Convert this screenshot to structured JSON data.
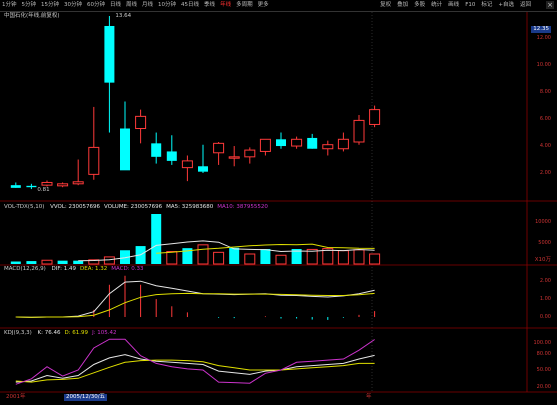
{
  "toolbar": {
    "periods": [
      "1分钟",
      "5分钟",
      "15分钟",
      "30分钟",
      "60分钟",
      "日线",
      "周线",
      "月线",
      "10分钟",
      "45日线",
      "季线",
      "年线",
      "多周期",
      "更多"
    ],
    "active_period": "年线",
    "right_items": [
      "复权",
      "叠加",
      "多股",
      "统计",
      "画线",
      "F10",
      "标记",
      "+自选",
      "返回"
    ]
  },
  "stock": {
    "name": "中国石化(年线,前复权)",
    "high_marker": "13.64",
    "low_marker": "0.81"
  },
  "price_axis": {
    "current": "12.35",
    "ticks": [
      "12.00",
      "10.00",
      "8.00",
      "6.00",
      "4.00",
      "2.00"
    ]
  },
  "vol": {
    "header": "VOL-TDX(5,10)",
    "items": [
      {
        "label": "VVOL:",
        "value": "230057696",
        "color": "#e6e6e6"
      },
      {
        "label": "VOLUME:",
        "value": "230057696",
        "color": "#e6e6e6"
      },
      {
        "label": "MA5:",
        "value": "325983680",
        "color": "#e6e6e6"
      },
      {
        "label": "MA10:",
        "value": "387955520",
        "color": "#cc33cc"
      }
    ],
    "axis": [
      "10000",
      "5000"
    ],
    "unit": "X10万"
  },
  "macd": {
    "header": "MACD(12,26,9)",
    "items": [
      {
        "label": "DIF:",
        "value": "1.49",
        "color": "#e6e6e6"
      },
      {
        "label": "DEA:",
        "value": "1.32",
        "color": "#e0e000"
      },
      {
        "label": "MACD:",
        "value": "0.33",
        "color": "#cc33cc"
      }
    ],
    "axis": [
      "2.00",
      "1.00",
      "0.00"
    ]
  },
  "kdj": {
    "header": "KDJ(9,3,3)",
    "items": [
      {
        "label": "K:",
        "value": "76.46",
        "color": "#e6e6e6"
      },
      {
        "label": "D:",
        "value": "61.99",
        "color": "#e0e000"
      },
      {
        "label": "J:",
        "value": "105.42",
        "color": "#cc33cc"
      }
    ],
    "axis": [
      "100.00",
      "80.00",
      "50.00",
      "20.00"
    ]
  },
  "timeline": {
    "start": "2001年",
    "cursor": "2005/12/30/五",
    "end_marker": "年"
  },
  "colors": {
    "up": "#ff3a3a",
    "down": "#00ffff",
    "dif": "#e6e6e6",
    "dea": "#e0e000",
    "j": "#cc33cc"
  },
  "chart_data": {
    "type": "candlestick",
    "candles": [
      {
        "o": 1.1,
        "h": 1.3,
        "l": 0.9,
        "c": 0.9
      },
      {
        "o": 1.05,
        "h": 1.2,
        "l": 0.81,
        "c": 0.95
      },
      {
        "o": 1.1,
        "h": 1.45,
        "l": 1.0,
        "c": 1.3
      },
      {
        "o": 1.05,
        "h": 1.3,
        "l": 0.95,
        "c": 1.2
      },
      {
        "o": 1.2,
        "h": 3.0,
        "l": 1.1,
        "c": 1.35
      },
      {
        "o": 1.9,
        "h": 6.9,
        "l": 1.5,
        "c": 3.9
      },
      {
        "o": 12.9,
        "h": 13.64,
        "l": 5.0,
        "c": 8.7
      },
      {
        "o": 5.3,
        "h": 7.3,
        "l": 2.5,
        "c": 2.2
      },
      {
        "o": 5.3,
        "h": 6.7,
        "l": 4.2,
        "c": 6.2
      },
      {
        "o": 4.2,
        "h": 5.0,
        "l": 2.7,
        "c": 3.2
      },
      {
        "o": 3.6,
        "h": 4.8,
        "l": 2.6,
        "c": 2.9
      },
      {
        "o": 2.4,
        "h": 3.3,
        "l": 1.4,
        "c": 2.9
      },
      {
        "o": 2.5,
        "h": 4.1,
        "l": 2.0,
        "c": 2.1
      },
      {
        "o": 3.5,
        "h": 4.3,
        "l": 2.6,
        "c": 4.2
      },
      {
        "o": 3.1,
        "h": 4.0,
        "l": 2.5,
        "c": 3.2
      },
      {
        "o": 3.2,
        "h": 3.9,
        "l": 2.7,
        "c": 3.7
      },
      {
        "o": 3.6,
        "h": 4.5,
        "l": 3.3,
        "c": 4.5
      },
      {
        "o": 4.5,
        "h": 5.0,
        "l": 3.8,
        "c": 4.0
      },
      {
        "o": 4.0,
        "h": 4.7,
        "l": 3.8,
        "c": 4.5
      },
      {
        "o": 4.6,
        "h": 4.9,
        "l": 3.8,
        "c": 3.8
      },
      {
        "o": 3.8,
        "h": 4.4,
        "l": 3.3,
        "c": 4.1
      },
      {
        "o": 3.8,
        "h": 5.0,
        "l": 3.6,
        "c": 4.5
      },
      {
        "o": 4.3,
        "h": 6.3,
        "l": 4.1,
        "c": 5.9
      },
      {
        "o": 5.6,
        "h": 7.0,
        "l": 5.4,
        "c": 6.7
      }
    ],
    "volume": [
      0.6,
      0.7,
      0.9,
      0.8,
      0.8,
      1.0,
      1.7,
      3.3,
      4.3,
      12.0,
      3.0,
      3.8,
      4.6,
      2.8,
      3.9,
      2.4,
      3.6,
      2.1,
      3.6,
      3.5,
      3.7,
      3.2,
      3.4,
      2.4
    ],
    "volume_up": [
      false,
      false,
      true,
      false,
      false,
      true,
      true,
      false,
      false,
      false,
      true,
      false,
      true,
      true,
      false,
      true,
      false,
      true,
      false,
      true,
      true,
      true,
      true,
      true
    ],
    "vol_ma5": [
      null,
      null,
      null,
      null,
      0.76,
      0.84,
      1.04,
      1.52,
      2.22,
      4.46,
      4.86,
      5.28,
      5.54,
      5.24,
      3.62,
      3.5,
      3.46,
      3.0,
      3.12,
      3.04,
      3.3,
      3.22,
      3.48,
      3.28
    ],
    "vol_ma10": [
      null,
      null,
      null,
      null,
      null,
      null,
      null,
      null,
      null,
      2.6,
      2.84,
      3.14,
      3.56,
      3.76,
      4.08,
      4.36,
      4.56,
      4.68,
      4.62,
      4.78,
      3.96,
      3.9,
      3.78,
      3.74
    ],
    "dif": [
      0.0,
      -0.02,
      0.0,
      0.0,
      0.05,
      0.3,
      1.3,
      1.95,
      2.0,
      1.75,
      1.6,
      1.45,
      1.3,
      1.28,
      1.25,
      1.28,
      1.3,
      1.22,
      1.2,
      1.15,
      1.12,
      1.18,
      1.3,
      1.49
    ],
    "dea": [
      0.0,
      -0.01,
      0.0,
      0.0,
      0.02,
      0.1,
      0.4,
      0.8,
      1.1,
      1.25,
      1.3,
      1.32,
      1.3,
      1.3,
      1.28,
      1.28,
      1.28,
      1.26,
      1.24,
      1.22,
      1.2,
      1.2,
      1.24,
      1.32
    ],
    "macd": [
      0.0,
      -0.02,
      0.0,
      0.0,
      0.06,
      0.4,
      1.8,
      2.3,
      1.8,
      1.0,
      0.6,
      0.26,
      0.0,
      -0.04,
      -0.06,
      0.0,
      0.04,
      -0.08,
      -0.08,
      -0.14,
      -0.16,
      -0.04,
      0.12,
      0.33
    ],
    "k": [
      28,
      30,
      40,
      35,
      40,
      60,
      72,
      78,
      70,
      66,
      64,
      62,
      60,
      48,
      45,
      42,
      48,
      50,
      56,
      58,
      60,
      62,
      70,
      76.46
    ],
    "d": [
      30,
      28,
      32,
      33,
      35,
      45,
      55,
      64,
      67,
      68,
      68,
      67,
      65,
      58,
      54,
      50,
      50,
      50,
      52,
      54,
      56,
      58,
      62,
      61.99
    ],
    "j": [
      24,
      34,
      56,
      39,
      50,
      90,
      106,
      106,
      76,
      62,
      56,
      52,
      50,
      28,
      27,
      26,
      44,
      50,
      64,
      66,
      68,
      70,
      86,
      105.42
    ]
  }
}
